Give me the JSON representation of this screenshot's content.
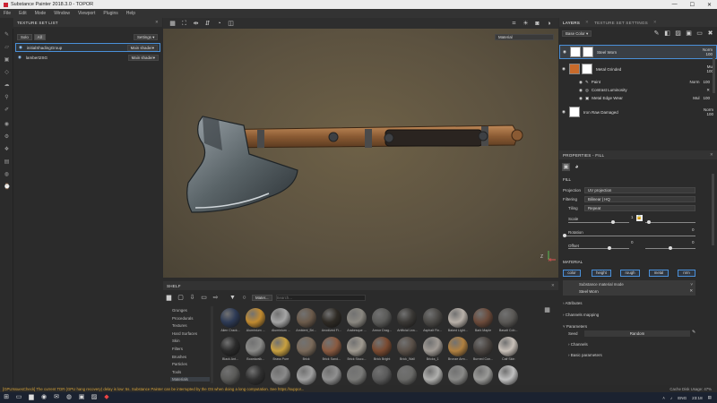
{
  "app": {
    "title": "Substance Painter 2018.3.0 - TOPOR",
    "window_controls": [
      "—",
      "☐",
      "✕"
    ]
  },
  "menu": [
    "File",
    "Edit",
    "Mode",
    "Window",
    "Viewport",
    "Plugins",
    "Help"
  ],
  "texture_set_list": {
    "title": "TEXTURE SET LIST",
    "tabs": [
      "Solo",
      "All"
    ],
    "settings_label": "Settings ▾",
    "rows": [
      {
        "name": "initialShadingGroup",
        "shader": "Main shader▾"
      },
      {
        "name": "lambert2SG",
        "shader": "Main shader▾"
      }
    ]
  },
  "viewport": {
    "mode_dropdown": "Material",
    "axis_z": "Z",
    "axis_x": "X"
  },
  "layers": {
    "tabs": [
      "LAYERS",
      "TEXTURE SET SETTINGS"
    ],
    "channel_dropdown": "Base Color ▾",
    "items": [
      {
        "name": "Steel Worn",
        "blend": "Norm",
        "opacity": "100"
      },
      {
        "name": "Metal Grinded",
        "blend": "Mul",
        "opacity": "100"
      },
      {
        "name": "Paint",
        "blend": "Norm",
        "opacity": "100"
      },
      {
        "name": "Contrast Luminosity",
        "blend": "",
        "opacity": ""
      },
      {
        "name": "Metal Edge Wear",
        "blend": "Mul",
        "opacity": "100"
      },
      {
        "name": "Iron Raw Damaged",
        "blend": "Norm",
        "opacity": "100"
      }
    ]
  },
  "properties": {
    "title": "PROPERTIES - FILL",
    "fill_label": "FILL",
    "projection_label": "Projection",
    "projection_value": "UV projection",
    "filtering_label": "Filtering",
    "filtering_value": "Bilinear | HQ",
    "tiling_label": "Tiling",
    "tiling_value": "Repeat",
    "scale_label": "Scale",
    "scale_value": "1",
    "rotation_label": "Rotation",
    "rotation_value": "0",
    "offset_label": "Offset",
    "offset_x": "0",
    "offset_y": "0",
    "material_label": "MATERIAL",
    "material_chips": [
      "color",
      "height",
      "rough",
      "metal",
      "nrm"
    ],
    "substance_mode_label": "Substance material mode",
    "substance_mode_value": "Steel Worn",
    "attributes_label": "Attributes",
    "channels_mapping_label": "Channels mapping",
    "parameters_label": "Parameters",
    "seed_label": "Seed",
    "seed_value": "Random",
    "channels_label": "Channels",
    "basic_params_label": "Basic parameters"
  },
  "shelf": {
    "title": "SHELF",
    "active_filter": "Mater...",
    "search_placeholder": "Search...",
    "categories": [
      "Grunges",
      "Procedurals",
      "Textures",
      "Hard Surfaces",
      "Skin",
      "Filters",
      "Brushes",
      "Particles",
      "Tools",
      "Materials"
    ],
    "materials_row1": [
      "Alien Crack...",
      "Aluminium ...",
      "Aluminium ...",
      "Ambient_Bri...",
      "Anodized Fi...",
      "Arabesque ...",
      "Armor Drag...",
      "Artificial Lea...",
      "Asphalt Fin...",
      "Baked Light...",
      "Bark Maple",
      "Basalt Cob..."
    ],
    "materials_row2": [
      "Black Ant...",
      "Boardwalk...",
      "Brass Pure",
      "Brick",
      "Brick Sand...",
      "Brick Stucc...",
      "Brick Bright",
      "Brick_Wall",
      "Bricks_1",
      "Bronze Arm...",
      "Burned Con...",
      "Calf Skin"
    ],
    "material_colors_row1": [
      "#2d3a55",
      "#c08a30",
      "#a5a5a5",
      "#6b5a4a",
      "#2e2a24",
      "#8a8780",
      "#5a5a58",
      "#3a3835",
      "#4a4845",
      "#b8b0a8",
      "#6b4a3a",
      "#5a5855"
    ],
    "material_colors_row2": [
      "#2a2a2a",
      "#8a8a88",
      "#c8a040",
      "#7a6a5a",
      "#8a5a40",
      "#a09a90",
      "#7a4a30",
      "#5a5048",
      "#a09a94",
      "#b08040",
      "#4a4440",
      "#c8c0b8"
    ],
    "material_colors_row3": [
      "#5a5a58",
      "#303030",
      "#8a8a8a",
      "#a0a0a0",
      "#909090",
      "#7a7a78",
      "#5a5a5a",
      "#6a6a68",
      "#b0b0ae",
      "#8a8a88",
      "#9a9a98",
      "#c0c0c0"
    ]
  },
  "status": {
    "message": "[GPUIssuesCheck] The current TDR (GPU hang recovery) delay is low: 5s. Substance Painter can be interrupted by the OS when doing a long computation. See https://suppor...",
    "cache": "Cache Disk Usage:  47%"
  },
  "taskbar": {
    "lang": "ENG",
    "time": "23:18"
  },
  "colors": {
    "accent_blue": "#4a90d9",
    "status_orange": "#d6a33a",
    "panel_bg": "#2b2b2b",
    "viewport_bg": "#5c5240"
  }
}
